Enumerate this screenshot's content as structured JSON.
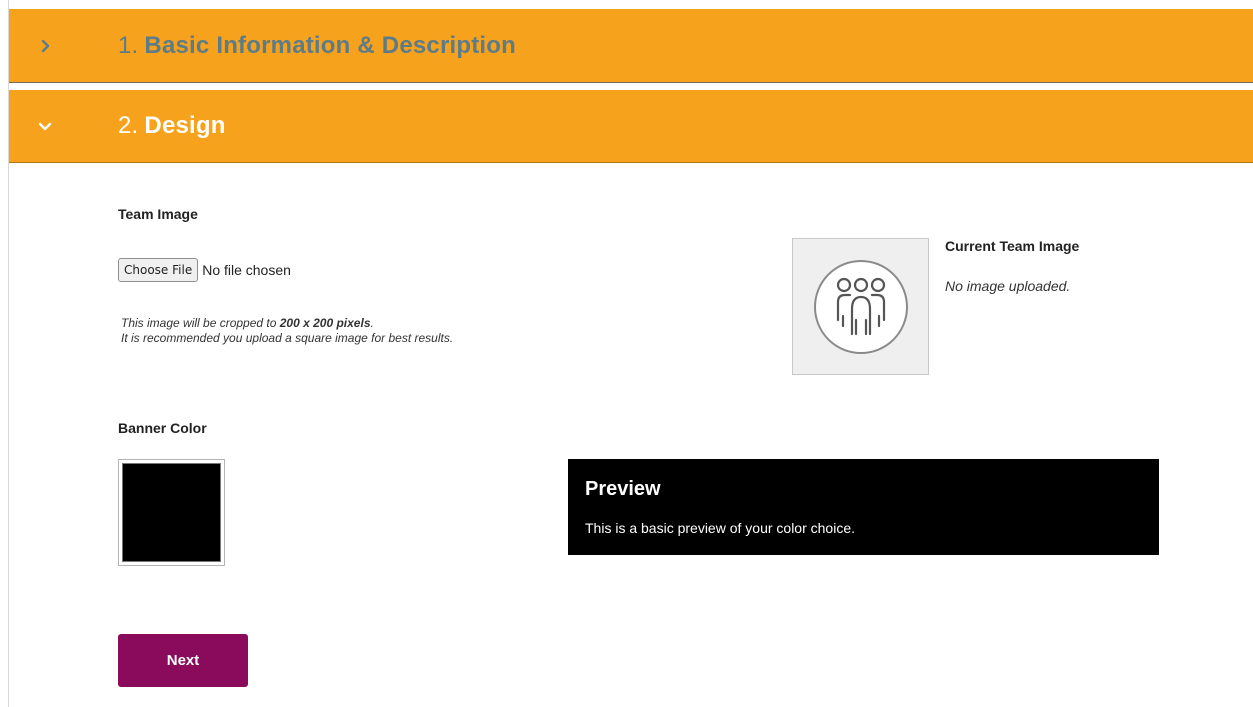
{
  "sections": [
    {
      "number": "1.",
      "title": "Basic Information & Description",
      "expanded": false
    },
    {
      "number": "2.",
      "title": "Design",
      "expanded": true
    }
  ],
  "team_image": {
    "label": "Team Image",
    "choose_button": "Choose File",
    "file_status": "No file chosen",
    "help_prefix": "This image will be cropped to ",
    "help_size": "200 x 200 pixels",
    "help_suffix": ".",
    "help_line2": "It is recommended you upload a square image for best results.",
    "current_title": "Current Team Image",
    "current_status": "No image uploaded.",
    "placeholder_icon": "team-group-icon"
  },
  "banner": {
    "label": "Banner Color",
    "color": "#000000",
    "preview_title": "Preview",
    "preview_text": "This is a basic preview of your color choice."
  },
  "actions": {
    "next_label": "Next"
  },
  "colors": {
    "accordion": "#f7a21d",
    "collapsed_title": "#5d7c88",
    "expanded_title": "#ffffff",
    "next_button": "#8a0a5b"
  }
}
